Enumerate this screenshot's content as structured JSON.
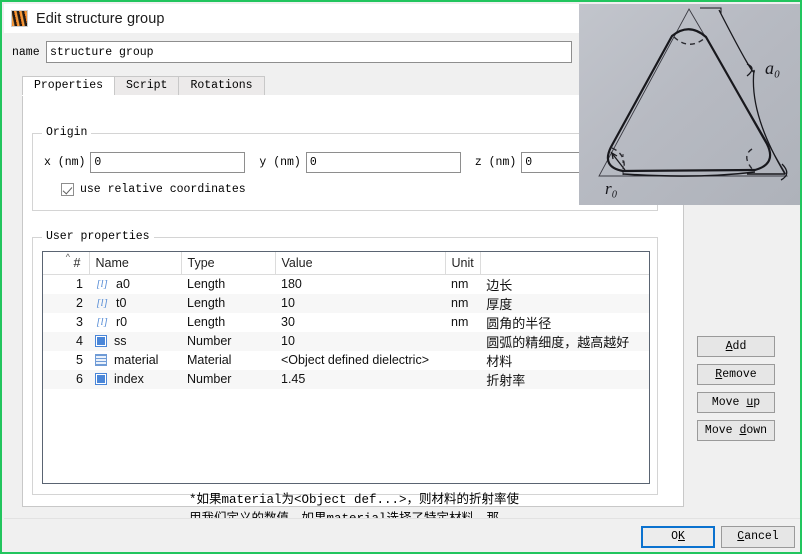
{
  "window": {
    "title": "Edit structure group",
    "icon": "lumerical-app-icon",
    "capture_border_color": "#22c55e"
  },
  "name_field": {
    "label": "name",
    "value": "structure group",
    "placeholder": ""
  },
  "tabs": [
    {
      "label": "Properties",
      "active": true
    },
    {
      "label": "Script",
      "active": false
    },
    {
      "label": "Rotations",
      "active": false
    }
  ],
  "origin": {
    "group_title": "Origin",
    "x_label": "x (nm)",
    "x_value": "0",
    "y_label": "y (nm)",
    "y_value": "0",
    "z_label": "z (nm)",
    "z_value": "0",
    "relative_checkbox_label": "use relative coordinates",
    "relative_checked": true
  },
  "user_properties": {
    "group_title": "User properties",
    "columns": [
      "#",
      "Name",
      "Type",
      "Value",
      "Unit",
      ""
    ],
    "sort_indicator": "^",
    "rows": [
      {
        "num": "1",
        "icon": "length-icon",
        "icon_glyph": "[l]",
        "name": "a0",
        "type": "Length",
        "value": "180",
        "unit": "nm",
        "desc": "边长"
      },
      {
        "num": "2",
        "icon": "length-icon",
        "icon_glyph": "[l]",
        "name": "t0",
        "type": "Length",
        "value": "10",
        "unit": "nm",
        "desc": "厚度"
      },
      {
        "num": "3",
        "icon": "length-icon",
        "icon_glyph": "[l]",
        "name": "r0",
        "type": "Length",
        "value": "30",
        "unit": "nm",
        "desc": "圆角的半径"
      },
      {
        "num": "4",
        "icon": "number-icon",
        "icon_glyph": "",
        "name": "ss",
        "type": "Number",
        "value": "10",
        "unit": "",
        "desc": "圆弧的精细度，越高越好"
      },
      {
        "num": "5",
        "icon": "material-icon",
        "icon_glyph": "",
        "name": "material",
        "type": "Material",
        "value": "<Object defined dielectric>",
        "unit": "",
        "desc": "材料"
      },
      {
        "num": "6",
        "icon": "number-icon",
        "icon_glyph": "",
        "name": "index",
        "type": "Number",
        "value": "1.45",
        "unit": "",
        "desc": "折射率"
      }
    ],
    "note": "*如果material为<Object def...>，则材料的折射率使\n用我们定义的数值，如果material选择了特定材料，那\n么我们定义的index不起作用"
  },
  "side_buttons": [
    {
      "name": "add",
      "pre": "",
      "accel": "A",
      "post": "dd"
    },
    {
      "name": "remove",
      "pre": "",
      "accel": "R",
      "post": "emove"
    },
    {
      "name": "move-up",
      "pre": "Move ",
      "accel": "u",
      "post": "p"
    },
    {
      "name": "move-down",
      "pre": "Move ",
      "accel": "d",
      "post": "own"
    }
  ],
  "footer": {
    "ok": {
      "pre": "O",
      "accel": "K",
      "post": ""
    },
    "cancel": {
      "pre": "",
      "accel": "C",
      "post": "ancel"
    }
  },
  "photo_overlay": {
    "description": "hand-drawn sketch of a rounded-corner equilateral triangle on gray paper",
    "label_side": "a₀",
    "label_radius": "r₀",
    "paper_color": "#b9bcc4",
    "ink_color": "#1d1d22"
  }
}
